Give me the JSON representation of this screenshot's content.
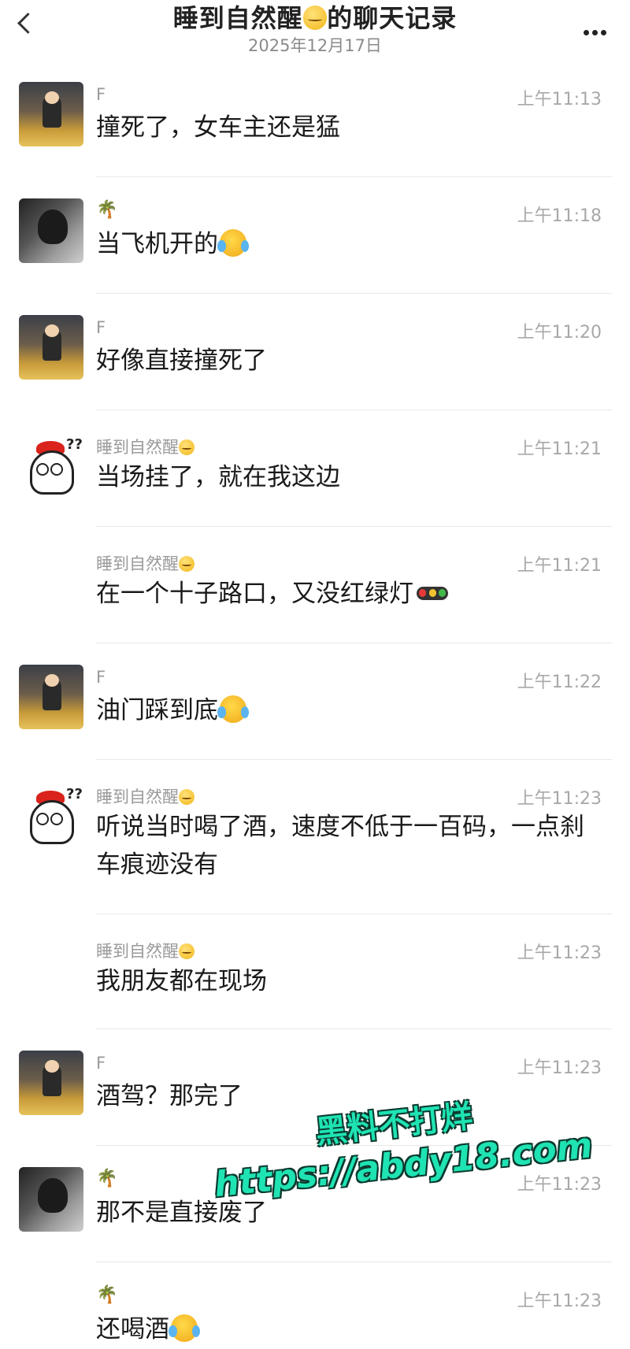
{
  "header": {
    "title_prefix": "睡到自然醒",
    "title_suffix": "的聊天记录",
    "date": "2025年12月17日"
  },
  "messages": [
    {
      "sender": "F",
      "time": "上午11:13",
      "text": "撞死了，女车主还是猛",
      "avatar": "car"
    },
    {
      "sender": "",
      "time": "上午11:18",
      "text": "当飞机开的",
      "avatar": "photo",
      "sender_icon": "palm-tree-icon",
      "trailing_emoji": "crying-laughing-emoji"
    },
    {
      "sender": "F",
      "time": "上午11:20",
      "text": "好像直接撞死了",
      "avatar": "car"
    },
    {
      "sender": "睡到自然醒",
      "time": "上午11:21",
      "text": "当场挂了，就在我这边",
      "avatar": "chicken"
    },
    {
      "sender": "睡到自然醒",
      "time": "上午11:21",
      "text": "在一个十子路口，又没红绿灯",
      "avatar": "none",
      "trailing_emoji": "traffic-light-emoji"
    },
    {
      "sender": "F",
      "time": "上午11:22",
      "text": "油门踩到底",
      "avatar": "car",
      "trailing_emoji": "crying-laughing-emoji"
    },
    {
      "sender": "睡到自然醒",
      "time": "上午11:23",
      "text": "听说当时喝了酒，速度不低于一百码，一点刹车痕迹没有",
      "avatar": "chicken"
    },
    {
      "sender": "睡到自然醒",
      "time": "上午11:23",
      "text": "我朋友都在现场",
      "avatar": "none"
    },
    {
      "sender": "F",
      "time": "上午11:23",
      "text": "酒驾？那完了",
      "avatar": "car"
    },
    {
      "sender": "",
      "time": "上午11:23",
      "text": "那不是直接废了",
      "avatar": "photo",
      "sender_icon": "palm-tree-icon"
    },
    {
      "sender": "",
      "time": "上午11:23",
      "text": "还喝酒",
      "avatar": "none",
      "sender_icon": "palm-tree-icon",
      "trailing_emoji": "crying-laughing-emoji"
    }
  ],
  "watermark": {
    "line1": "黑料不打烊",
    "line2": "https://abdy18.com"
  }
}
